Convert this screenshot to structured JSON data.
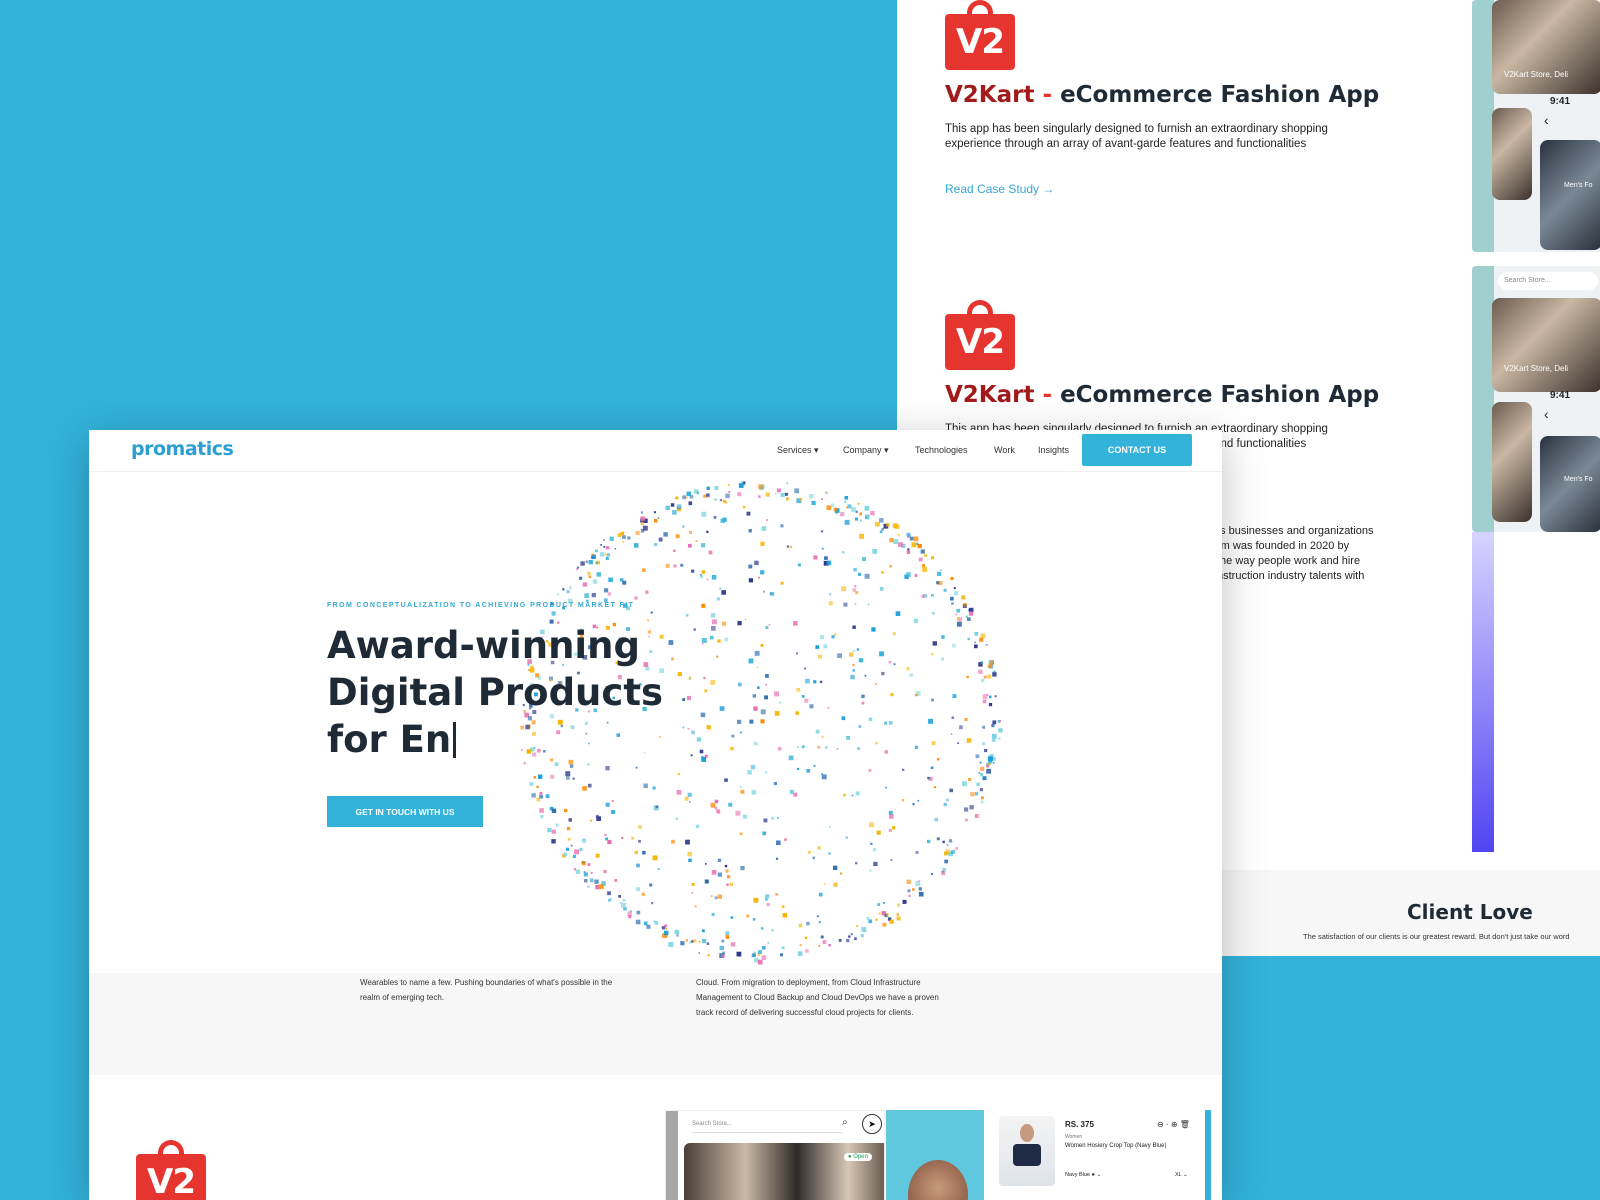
{
  "case_study": {
    "logo_text": "V2",
    "brand": "V2Kart",
    "dash": "-",
    "title": "eCommerce Fashion App",
    "description": "This app has been singularly designed to furnish an extraordinary shopping experience through an array of avant-garde features and functionalities",
    "link": "Read Case Study →"
  },
  "phone_mock": {
    "store_label": "V2Kart Store, Deli",
    "time": "9:41",
    "category": "Men's Fo",
    "search_placeholder": "Search Store..."
  },
  "about_snippet": [
    "ts businesses and organizations",
    "rm was founded in 2020 by",
    "the way people work and hire",
    "nstruction industry talents with"
  ],
  "client_love": {
    "title": "Client Love",
    "subtitle": "The satisfaction of our clients is our greatest reward. But don't just take our word"
  },
  "nav": {
    "logo": "promatics",
    "items": [
      "Services ▾",
      "Company ▾",
      "Technologies",
      "Work",
      "Insights"
    ],
    "cta": "CONTACT US"
  },
  "hero": {
    "eyebrow": "FROM CONCEPTUALIZATION TO ACHIEVING PRODUCT MARKET FIT",
    "line1": "Award-winning",
    "line2": "Digital Products",
    "line3": "for En",
    "button": "GET IN TOUCH WITH US"
  },
  "services_band": {
    "left": "Wearables to name a few. Pushing boundaries of what's possible in the realm of emerging tech.",
    "right": "Cloud. From migration to deployment, from Cloud Infrastructure Management to Cloud Backup and Cloud DevOps we have a proven track record of delivering successful cloud projects for clients."
  },
  "product_mock": {
    "search_placeholder": "Search Store...",
    "open_badge": "● Open",
    "price": "RS. 375",
    "category": "Women",
    "name": "Women Hosiery Crop Top (Navy Blue)",
    "color": "Navy Blue ● ⌄",
    "size": "XL ⌄"
  },
  "colors": {
    "background": "#33b2da",
    "accent": "#33b2da",
    "brand_red": "#e5352e",
    "heading": "#1f2a37"
  },
  "sphere_palette": [
    "#2b6cb0",
    "#33b2da",
    "#f6b400",
    "#e86fb0",
    "#1a9bd7",
    "#7fd7e0",
    "#ff8a00",
    "#2d3a8c"
  ]
}
